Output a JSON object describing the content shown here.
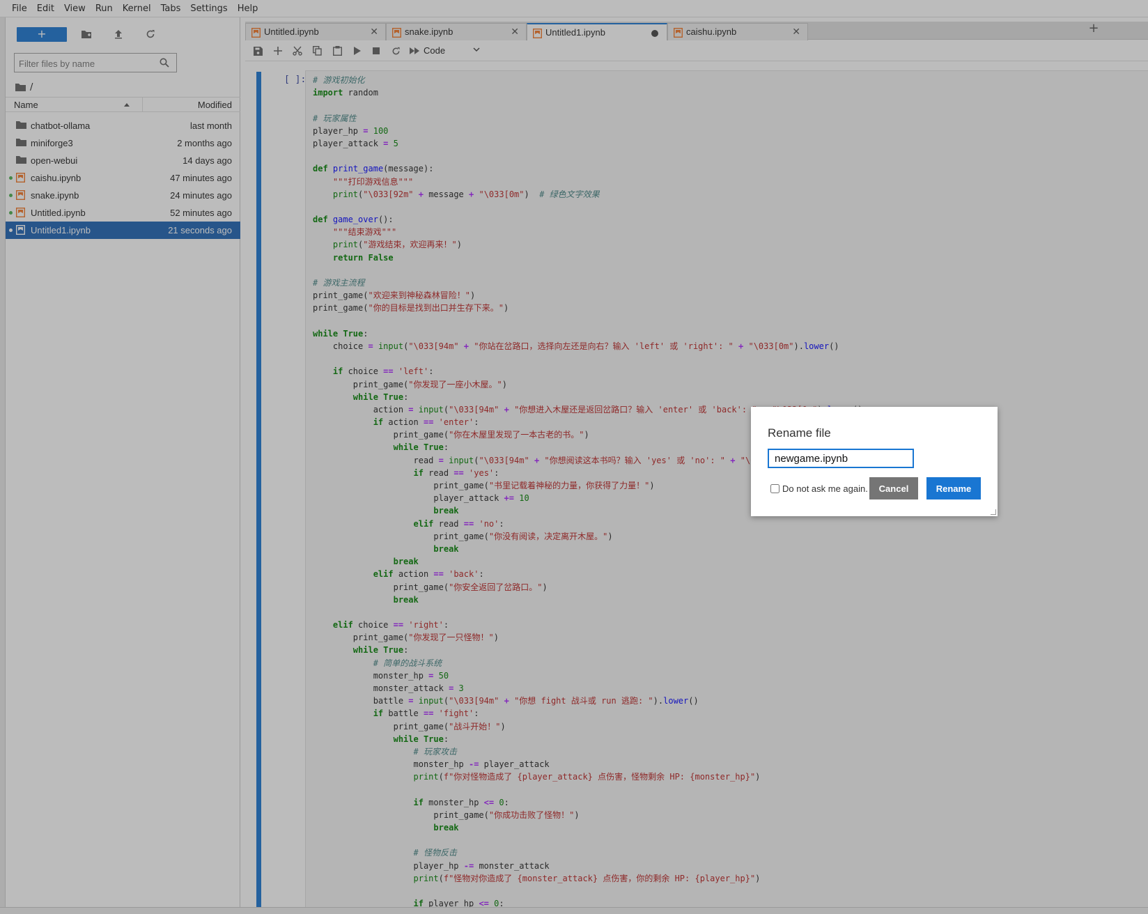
{
  "menubar": {
    "items": [
      "File",
      "Edit",
      "View",
      "Run",
      "Kernel",
      "Tabs",
      "Settings",
      "Help"
    ]
  },
  "filebrowser": {
    "new_button": "+",
    "filter_placeholder": "Filter files by name",
    "breadcrumb": "/",
    "columns": {
      "name": "Name",
      "modified": "Modified"
    },
    "files": [
      {
        "name": "chatbot-ollama",
        "modified": "last month",
        "type": "folder",
        "running": false,
        "selected": false
      },
      {
        "name": "miniforge3",
        "modified": "2 months ago",
        "type": "folder",
        "running": false,
        "selected": false
      },
      {
        "name": "open-webui",
        "modified": "14 days ago",
        "type": "folder",
        "running": false,
        "selected": false
      },
      {
        "name": "caishu.ipynb",
        "modified": "47 minutes ago",
        "type": "notebook",
        "running": true,
        "selected": false
      },
      {
        "name": "snake.ipynb",
        "modified": "24 minutes ago",
        "type": "notebook",
        "running": true,
        "selected": false
      },
      {
        "name": "Untitled.ipynb",
        "modified": "52 minutes ago",
        "type": "notebook",
        "running": true,
        "selected": false
      },
      {
        "name": "Untitled1.ipynb",
        "modified": "21 seconds ago",
        "type": "notebook",
        "running": true,
        "selected": true
      }
    ]
  },
  "tabs": [
    {
      "label": "Untitled.ipynb",
      "active": false,
      "dirty": false
    },
    {
      "label": "snake.ipynb",
      "active": false,
      "dirty": false
    },
    {
      "label": "Untitled1.ipynb",
      "active": true,
      "dirty": true
    },
    {
      "label": "caishu.ipynb",
      "active": false,
      "dirty": false
    }
  ],
  "toolbar": {
    "cell_type": "Code"
  },
  "cell": {
    "prompt": "[ ]:",
    "code": [
      "# 游戏初始化",
      "import random",
      "",
      "# 玩家属性",
      "player_hp = 100",
      "player_attack = 5",
      "",
      "def print_game(message):",
      "    \"\"\"打印游戏信息\"\"\"",
      "    print(\"\\033[92m\" + message + \"\\033[0m\")  # 绿色文字效果",
      "",
      "def game_over():",
      "    \"\"\"结束游戏\"\"\"",
      "    print(\"游戏结束，欢迎再来！\")",
      "    return False",
      "",
      "# 游戏主流程",
      "print_game(\"欢迎来到神秘森林冒险！\")",
      "print_game(\"你的目标是找到出口并生存下来。\")",
      "",
      "while True:",
      "    choice = input(\"\\033[94m\" + \"你站在岔路口，选择向左还是向右？输入 'left' 或 'right': \" + \"\\033[0m\").lower()",
      "",
      "    if choice == 'left':",
      "        print_game(\"你发现了一座小木屋。\")",
      "        while True:",
      "            action = input(\"\\033[94m\" + \"你想进入木屋还是返回岔路口？输入 'enter' 或 'back': \" + \"\\033[0m\").lower()",
      "            if action == 'enter':",
      "                print_game(\"你在木屋里发现了一本古老的书。\")",
      "                while True:",
      "                    read = input(\"\\033[94m\" + \"你想阅读这本书吗？输入 'yes' 或 'no': \" + \"\\033[0m\").lower()",
      "                    if read == 'yes':",
      "                        print_game(\"书里记载着神秘的力量，你获得了力量！\")",
      "                        player_attack += 10",
      "                        break",
      "                    elif read == 'no':",
      "                        print_game(\"你没有阅读，决定离开木屋。\")",
      "                        break",
      "                break",
      "            elif action == 'back':",
      "                print_game(\"你安全返回了岔路口。\")",
      "                break",
      "",
      "    elif choice == 'right':",
      "        print_game(\"你发现了一只怪物！\")",
      "        while True:",
      "            # 简单的战斗系统",
      "            monster_hp = 50",
      "            monster_attack = 3",
      "            battle = input(\"\\033[94m\" + \"你想 fight 战斗或 run 逃跑: \").lower()",
      "            if battle == 'fight':",
      "                print_game(\"战斗开始！\")",
      "                while True:",
      "                    # 玩家攻击",
      "                    monster_hp -= player_attack",
      "                    print(f\"你对怪物造成了 {player_attack} 点伤害，怪物剩余 HP: {monster_hp}\")",
      "",
      "                    if monster_hp <= 0:",
      "                        print_game(\"你成功击败了怪物！\")",
      "                        break",
      "",
      "                    # 怪物反击",
      "                    player_hp -= monster_attack",
      "                    print(f\"怪物对你造成了 {monster_attack} 点伤害，你的剩余 HP: {player_hp}\")",
      "",
      "                    if player_hp <= 0:"
    ]
  },
  "dialog": {
    "title": "Rename file",
    "input_value": "newgame.ipynb",
    "checkbox_label": "Do not ask me again.",
    "cancel_label": "Cancel",
    "rename_label": "Rename"
  },
  "colors": {
    "accent": "#1976d2",
    "selected_row": "#1e63b4",
    "running_dot": "#4caf50",
    "notebook_icon": "#f37726"
  }
}
